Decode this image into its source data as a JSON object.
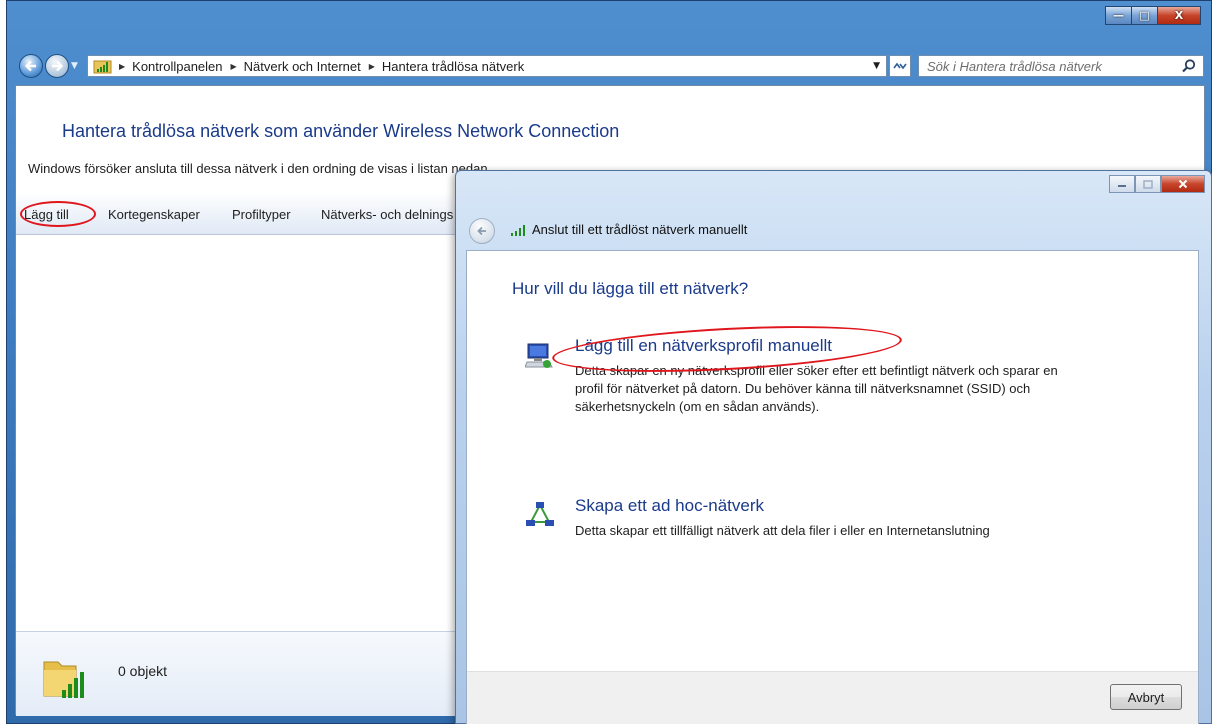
{
  "window": {
    "caption_min": "—",
    "caption_max": "□",
    "caption_close": "X"
  },
  "navigation": {
    "breadcrumbs": [
      "Kontrollpanelen",
      "Nätverk och Internet",
      "Hantera trådlösa nätverk"
    ],
    "search_placeholder": "Sök i Hantera trådlösa nätverk"
  },
  "content": {
    "title": "Hantera trådlösa nätverk som använder Wireless Network Connection",
    "description": "Windows försöker ansluta till dessa nätverk i den ordning de visas i listan nedan."
  },
  "toolbar": {
    "items": [
      "Lägg till",
      "Kortegenskaper",
      "Profiltyper",
      "Nätverks- och delnings"
    ]
  },
  "statusbar": {
    "count": "0 objekt"
  },
  "dialog": {
    "title": "Anslut till ett trådlöst nätverk manuellt",
    "heading": "Hur vill du lägga till ett nätverk?",
    "options": [
      {
        "title": "Lägg till en nätverksprofil manuellt",
        "description": "Detta skapar en ny nätverksprofil eller söker efter ett befintligt nätverk och sparar en profil för nätverket på datorn. Du behöver känna till nätverksnamnet (SSID) och säkerhetsnyckeln (om en sådan används)."
      },
      {
        "title": "Skapa ett ad hoc-nätverk",
        "description": "Detta skapar ett tillfälligt nätverk att dela filer i eller en Internetanslutning"
      }
    ],
    "cancel_label": "Avbryt"
  },
  "colors": {
    "link_blue": "#1a3a8a",
    "annotation_red": "#e0161d",
    "titlebar_blue": "#3d7cc0"
  }
}
